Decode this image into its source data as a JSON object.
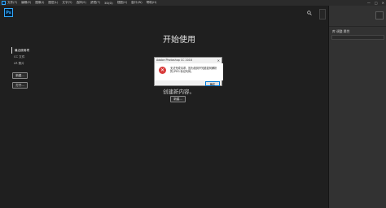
{
  "menubar": {
    "items": [
      "文件(F)",
      "编辑(E)",
      "图像(I)",
      "图层(L)",
      "文字(Y)",
      "选择(S)",
      "滤镜(T)",
      "3D(D)",
      "视图(V)",
      "窗口(W)",
      "帮助(H)"
    ],
    "minimize": "—",
    "maximize": "□",
    "close": "✕"
  },
  "logo": {
    "text": "Ps"
  },
  "main": {
    "title": "开始使用",
    "create_text": "创建新内容。",
    "create_button": "新建..."
  },
  "left_nav": {
    "items": [
      {
        "label": "最近使用项"
      },
      {
        "label": "CC 文件"
      },
      {
        "label": "LR 照片"
      }
    ],
    "new_button": "新建...",
    "open_button": "打开..."
  },
  "right_panel": {
    "tab_label": "库 调整 属性"
  },
  "dialog": {
    "title": "Adobe Photoshop CC 2018",
    "close": "✕",
    "message": "无法完成请求，因为找到不知道如何解析的 JPEG 标记代码。",
    "ok_label": "确定"
  },
  "colors": {
    "accent": "#31a8ff",
    "error": "#d83b3b",
    "background": "#1f1f1f",
    "panel": "#323232"
  }
}
